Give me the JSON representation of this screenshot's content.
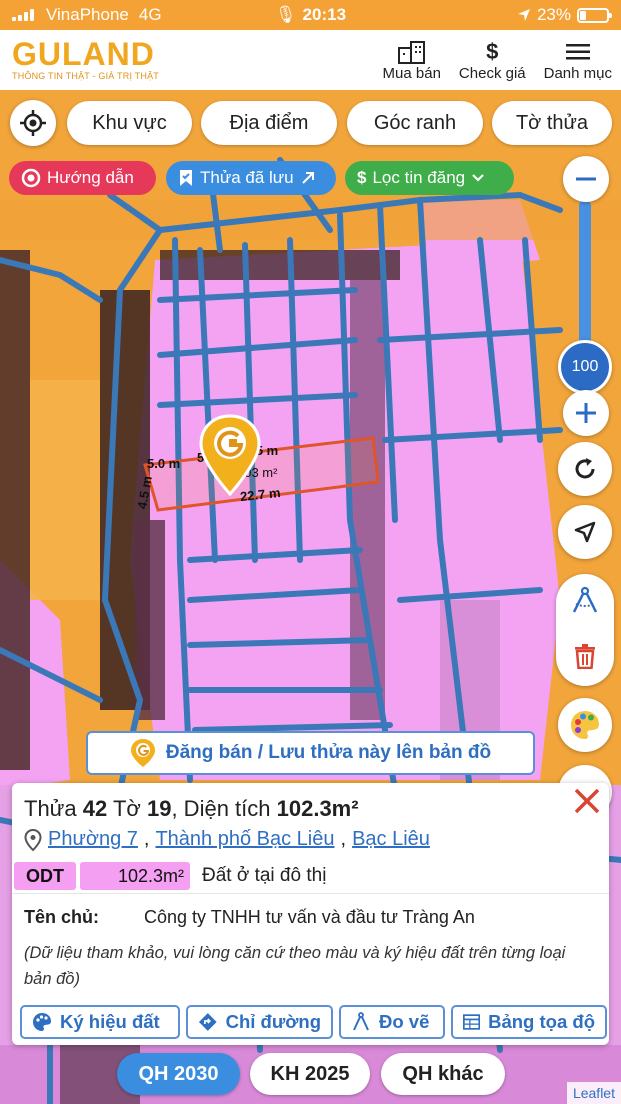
{
  "status_bar": {
    "carrier": "VinaPhone",
    "network": "4G",
    "time": "20:13",
    "battery": "23%"
  },
  "header": {
    "logo_text": "GULAND",
    "logo_tagline": "THÔNG TIN THẬT - GIÁ TRỊ THẬT",
    "nav": [
      {
        "label": "Mua bán",
        "icon": "building-icon"
      },
      {
        "label": "Check giá",
        "icon": "dollar-icon"
      },
      {
        "label": "Danh mục",
        "icon": "menu-icon"
      }
    ]
  },
  "filters": {
    "pills": [
      "Khu vực",
      "Địa điểm",
      "Góc ranh",
      "Tờ thửa"
    ],
    "chips": [
      {
        "label": "Hướng dẫn",
        "color": "#e6395a",
        "icon": "target-icon"
      },
      {
        "label": "Thửa đã lưu",
        "color": "#3b8de0",
        "icon": "bookmark-icon"
      },
      {
        "label": "Lọc tin đăng",
        "color": "#3fae4a",
        "icon": "dollar-icon"
      }
    ]
  },
  "map": {
    "zoom_level": "100",
    "parcel_labels": {
      "top_left": "5.0 m",
      "top_mid": "5.0 m",
      "top_right": "4.5 m",
      "left": "4.5 m",
      "area": "103 m²",
      "bottom": "22.7 m"
    },
    "colors": {
      "residential": "#f3a3f1",
      "commercial": "#f2a53b",
      "boundary": "#3b78b8",
      "selected": "#e0542a"
    }
  },
  "post_banner": {
    "label": "Đăng bán / Lưu thửa này lên bản đồ"
  },
  "parcel_info": {
    "title_prefix": "Thửa",
    "parcel_no": "42",
    "sheet_prefix": "Tờ",
    "sheet_no": "19",
    "area_prefix": ", Diện tích",
    "area": "102.3m²",
    "address": [
      "Phường 7",
      "Thành phố Bạc Liêu",
      "Bạc Liêu"
    ],
    "land_code": "ODT",
    "land_area": "102.3m²",
    "land_desc": "Đất ở tại đô thị",
    "owner_label": "Tên chủ:",
    "owner_value": "Công ty TNHH tư vấn và đầu tư Tràng An",
    "note": "(Dữ liệu tham khảo, vui lòng căn cứ theo màu và ký hiệu đất trên từng loại bản đồ)",
    "actions": [
      {
        "label": "Ký hiệu đất",
        "icon": "palette-icon"
      },
      {
        "label": "Chỉ đường",
        "icon": "directions-icon"
      },
      {
        "label": "Đo vẽ",
        "icon": "measure-icon"
      },
      {
        "label": "Bảng tọa độ",
        "icon": "table-icon"
      }
    ]
  },
  "bottom_tabs": [
    "QH 2030",
    "KH 2025",
    "QH khác"
  ],
  "attribution": "Leaflet"
}
